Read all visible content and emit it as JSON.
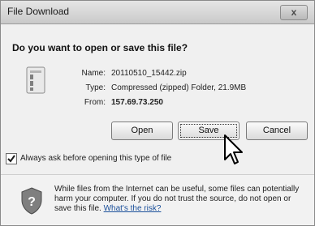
{
  "window": {
    "title": "File Download",
    "close_label": "x"
  },
  "dialog": {
    "question": "Do you want to open or save this file?",
    "file": {
      "name_label": "Name:",
      "name_value": "20110510_15442.zip",
      "type_label": "Type:",
      "type_value": "Compressed (zipped) Folder, 21.9MB",
      "from_label": "From:",
      "from_value": "157.69.73.250"
    },
    "buttons": {
      "open": "Open",
      "save": "Save",
      "cancel": "Cancel"
    },
    "checkbox": {
      "label": "Always ask before opening this type of file",
      "checked": true
    },
    "warning": {
      "text": "While files from the Internet can be useful, some files can potentially harm your computer. If you do not trust the source, do not open or save this file.",
      "link": "What's the risk?"
    }
  },
  "icons": {
    "file": "zip-file-icon",
    "shield": "security-shield-icon",
    "cursor": "mouse-pointer-icon",
    "check": "checkmark-icon"
  },
  "colors": {
    "link": "#1a4f9a"
  }
}
